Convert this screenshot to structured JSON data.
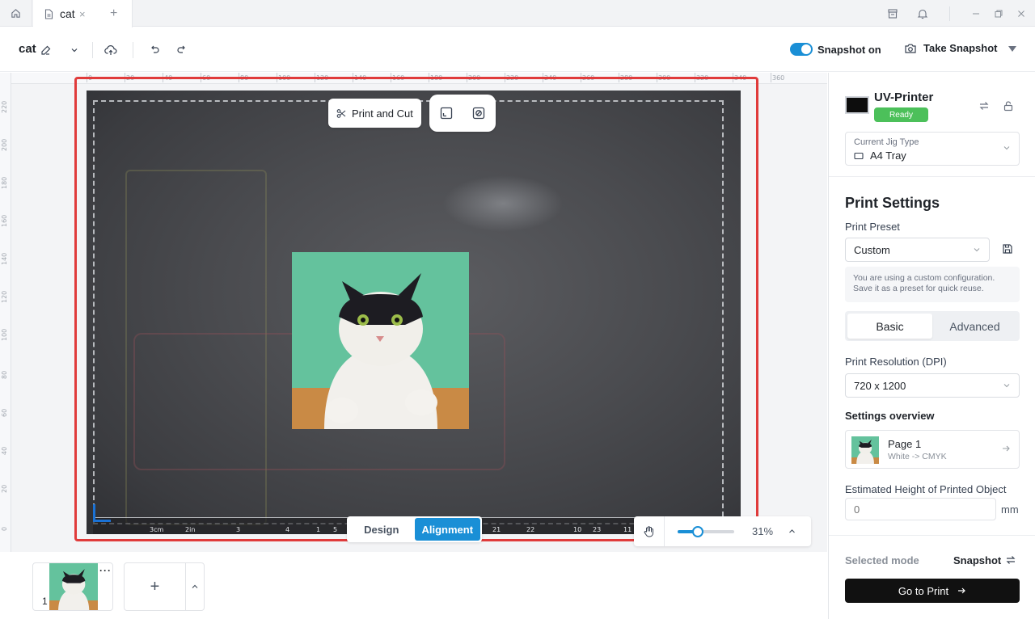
{
  "titlebar": {
    "tab_title": "cat",
    "tab_close": "×",
    "tab_add": "+"
  },
  "toolbar": {
    "doc_name": "cat",
    "snapshot_label": "Snapshot on",
    "snapshot_on": true,
    "take_snapshot_label": "Take Snapshot"
  },
  "rulers": {
    "top": [
      "0",
      "20",
      "40",
      "60",
      "80",
      "100",
      "120",
      "140",
      "160",
      "180",
      "200",
      "220",
      "240",
      "260",
      "280",
      "300",
      "320",
      "340",
      "360"
    ],
    "left": [
      "220",
      "200",
      "180",
      "160",
      "140",
      "120",
      "100",
      "80",
      "60",
      "40",
      "20",
      "0"
    ]
  },
  "bed_scale": [
    "3cm",
    "2in",
    "3",
    "4",
    "1",
    "5",
    "21",
    "22",
    "10",
    "23",
    "11"
  ],
  "canvas": {
    "print_and_cut_label": "Print and Cut",
    "mode_tabs": [
      "Design",
      "Alignment"
    ],
    "active_mode_tab": "Alignment",
    "zoom_percent": "31%",
    "zoom_level": 0.35
  },
  "pages": {
    "thumb_number": "1",
    "thumb_more": "···",
    "add_label": "+"
  },
  "right_panel": {
    "printer_name": "UV-Printer",
    "status": "Ready",
    "jig_label": "Current Jig Type",
    "jig_value": "A4 Tray",
    "print_settings_title": "Print Settings",
    "preset_label": "Print Preset",
    "preset_value": "Custom",
    "preset_info_line1": "You are using a custom configuration.",
    "preset_info_line2": "Save it as a preset for quick reuse.",
    "tabs": [
      "Basic",
      "Advanced"
    ],
    "active_tab": "Basic",
    "resolution_label": "Print Resolution (DPI)",
    "resolution_value": "720 x 1200",
    "overview_label": "Settings overview",
    "page_card_title": "Page 1",
    "page_card_sub": "White -> CMYK",
    "height_label": "Estimated Height of Printed Object",
    "height_placeholder": "0",
    "height_unit": "mm",
    "selected_mode_label": "Selected mode",
    "selected_mode_value": "Snapshot",
    "go_print_label": "Go to Print"
  },
  "colors": {
    "accent": "#1a8fd6",
    "ready": "#4cc05a",
    "selection": "#e03b3b"
  }
}
